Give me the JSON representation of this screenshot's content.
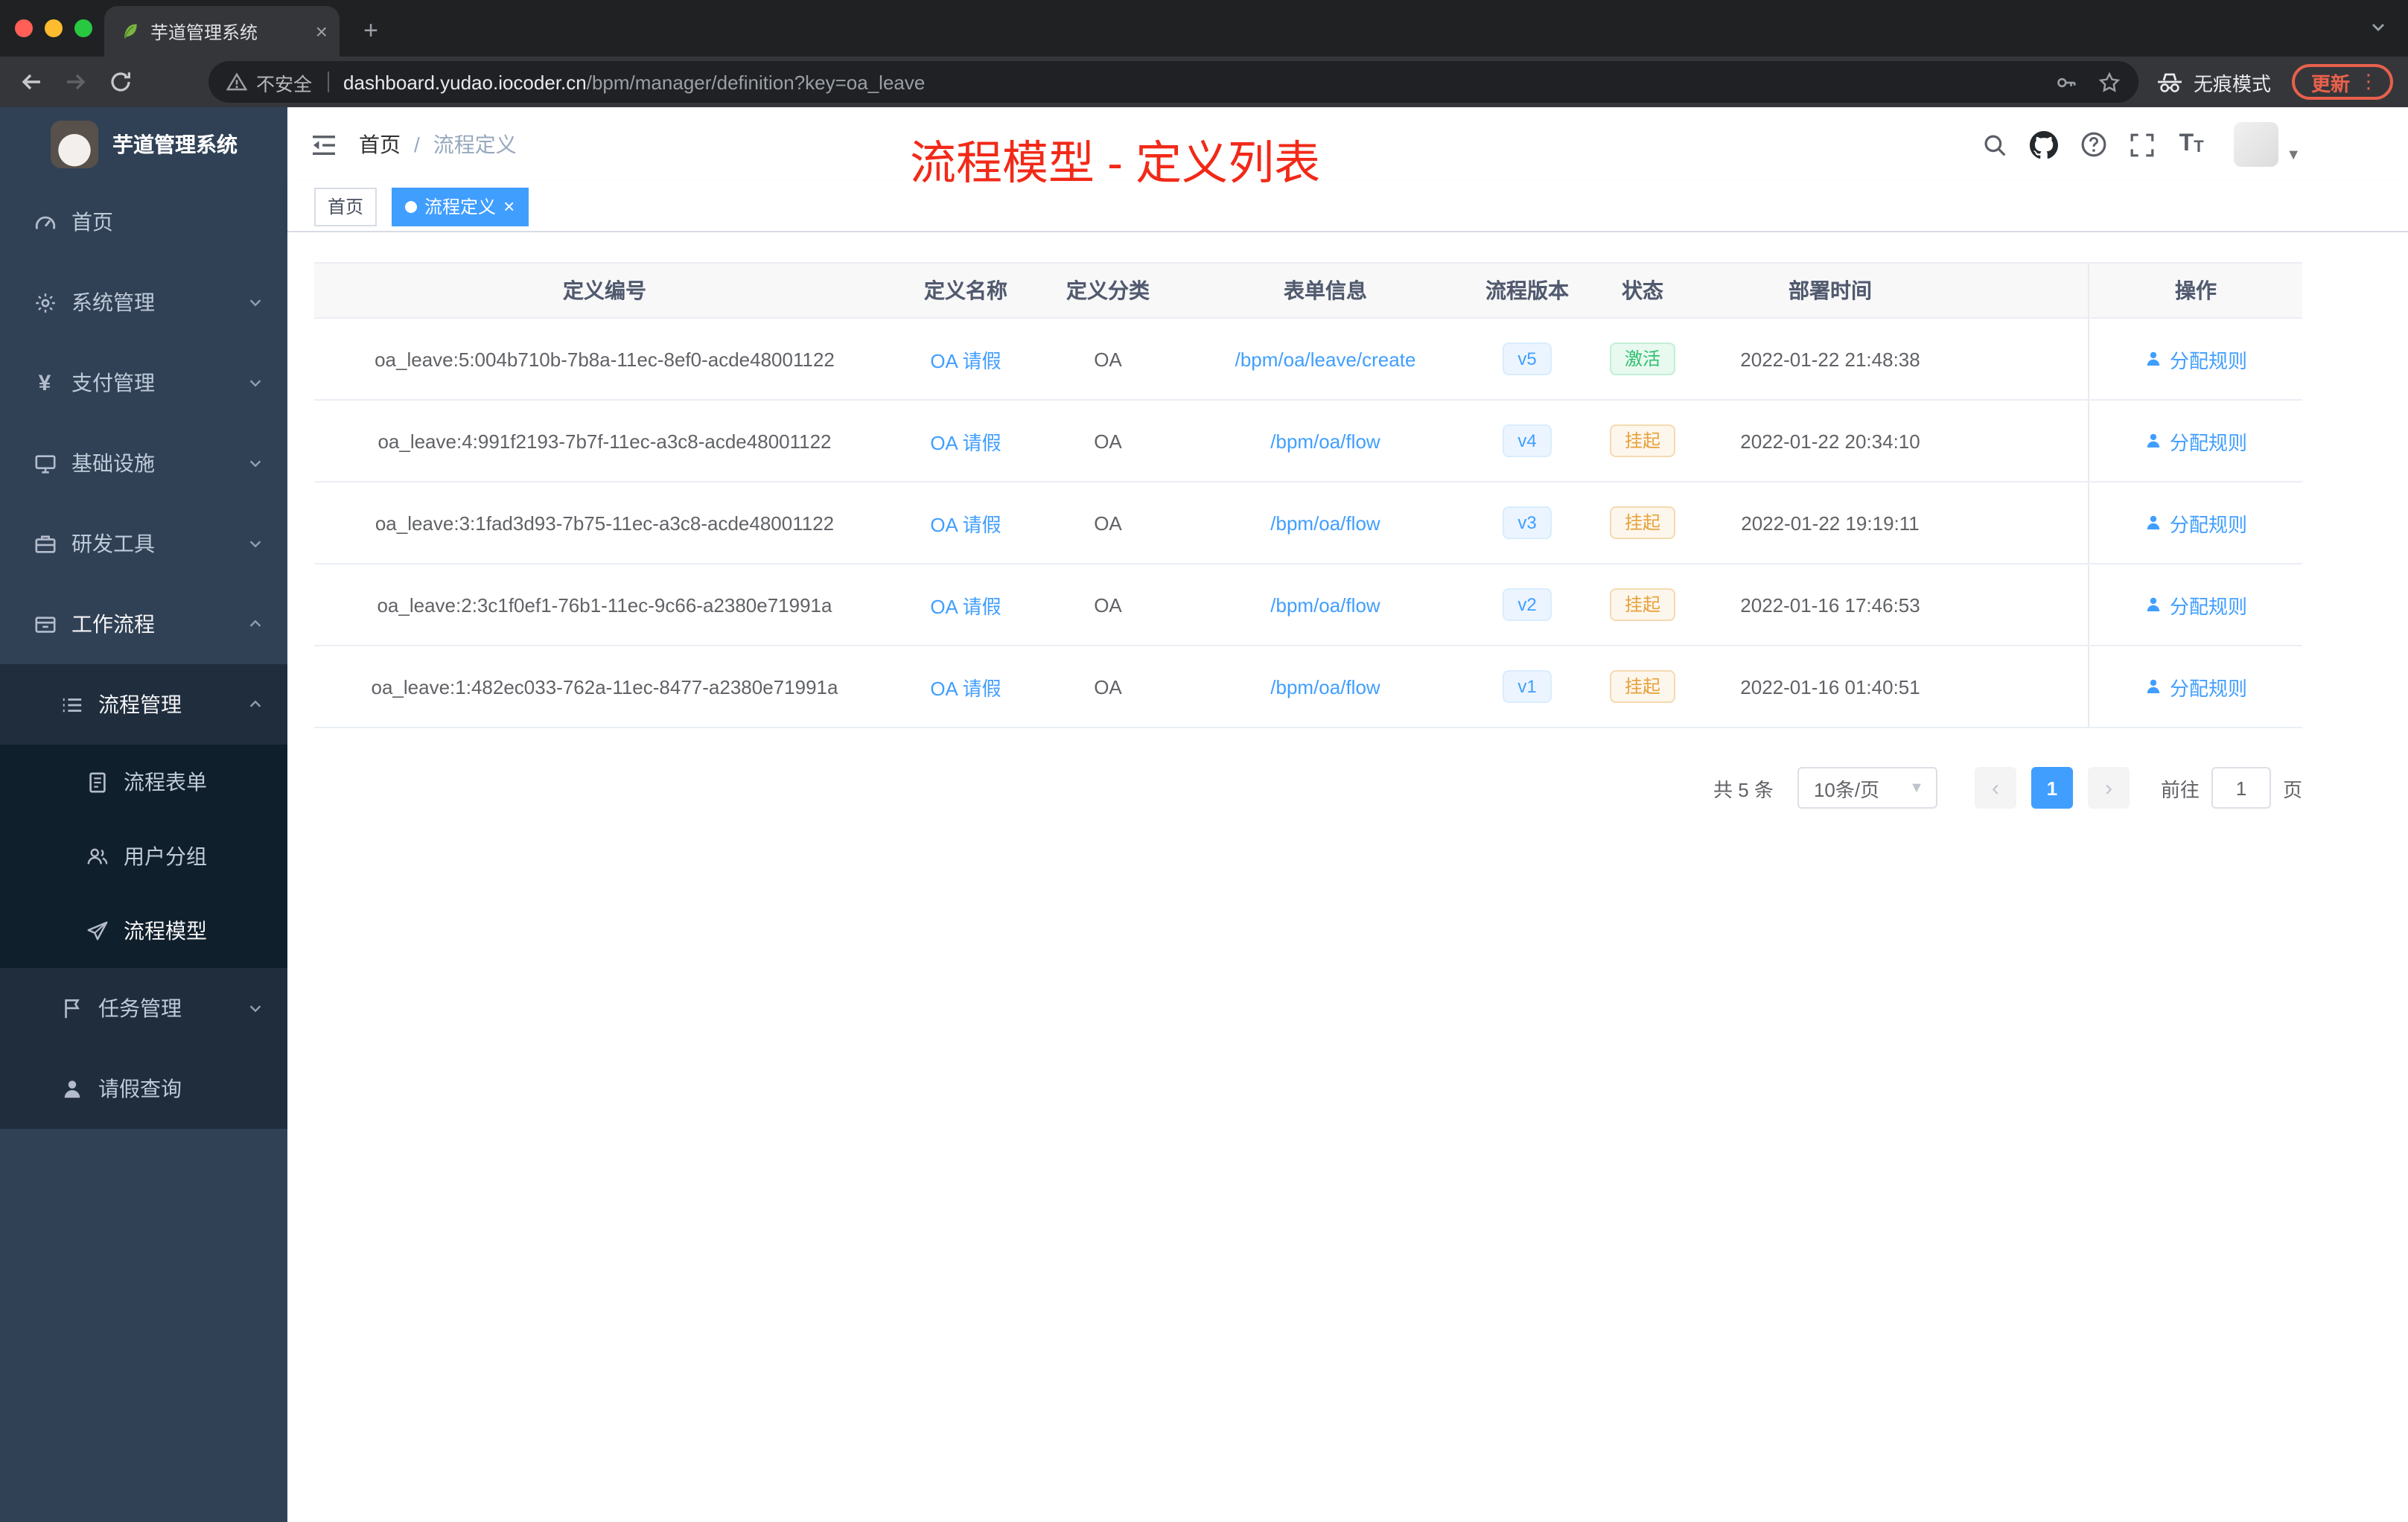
{
  "browser": {
    "tab_title": "芋道管理系统",
    "new_tab_label": "+",
    "close_label": "×",
    "security_label": "不安全",
    "url_domain": "dashboard.yudao.iocoder.cn",
    "url_path": "/bpm/manager/definition?key=oa_leave",
    "incognito_label": "无痕模式",
    "update_label": "更新",
    "menu_dots": "⋮"
  },
  "sidebar": {
    "logo_title": "芋道管理系统",
    "items": [
      {
        "label": "首页"
      },
      {
        "label": "系统管理"
      },
      {
        "label": "支付管理"
      },
      {
        "label": "基础设施"
      },
      {
        "label": "研发工具"
      },
      {
        "label": "工作流程"
      },
      {
        "label": "流程管理"
      },
      {
        "label": "流程表单"
      },
      {
        "label": "用户分组"
      },
      {
        "label": "流程模型"
      },
      {
        "label": "任务管理"
      },
      {
        "label": "请假查询"
      }
    ]
  },
  "navbar": {
    "breadcrumb_home": "首页",
    "breadcrumb_sep": "/",
    "breadcrumb_current": "流程定义",
    "annotation": "流程模型 - 定义列表"
  },
  "tags": {
    "home": "首页",
    "active": "流程定义",
    "close": "×"
  },
  "table": {
    "columns": [
      "定义编号",
      "定义名称",
      "定义分类",
      "表单信息",
      "流程版本",
      "状态",
      "部署时间",
      "操作"
    ],
    "rows": [
      {
        "id": "oa_leave:5:004b710b-7b8a-11ec-8ef0-acde48001122",
        "name": "OA 请假",
        "category": "OA",
        "form": "/bpm/oa/leave/create",
        "version": "v5",
        "status": "激活",
        "status_type": "success",
        "time": "2022-01-22 21:48:38",
        "action": "分配规则"
      },
      {
        "id": "oa_leave:4:991f2193-7b7f-11ec-a3c8-acde48001122",
        "name": "OA 请假",
        "category": "OA",
        "form": "/bpm/oa/flow",
        "version": "v4",
        "status": "挂起",
        "status_type": "warning",
        "time": "2022-01-22 20:34:10",
        "action": "分配规则"
      },
      {
        "id": "oa_leave:3:1fad3d93-7b75-11ec-a3c8-acde48001122",
        "name": "OA 请假",
        "category": "OA",
        "form": "/bpm/oa/flow",
        "version": "v3",
        "status": "挂起",
        "status_type": "warning",
        "time": "2022-01-22 19:19:11",
        "action": "分配规则"
      },
      {
        "id": "oa_leave:2:3c1f0ef1-76b1-11ec-9c66-a2380e71991a",
        "name": "OA 请假",
        "category": "OA",
        "form": "/bpm/oa/flow",
        "version": "v2",
        "status": "挂起",
        "status_type": "warning",
        "time": "2022-01-16 17:46:53",
        "action": "分配规则"
      },
      {
        "id": "oa_leave:1:482ec033-762a-11ec-8477-a2380e71991a",
        "name": "OA 请假",
        "category": "OA",
        "form": "/bpm/oa/flow",
        "version": "v1",
        "status": "挂起",
        "status_type": "warning",
        "time": "2022-01-16 01:40:51",
        "action": "分配规则"
      }
    ]
  },
  "pagination": {
    "total": "共 5 条",
    "page_size": "10条/页",
    "prev": "‹",
    "page": "1",
    "next": "›",
    "goto_label": "前往",
    "goto_value": "1",
    "page_unit": "页"
  },
  "colors": {
    "accent": "#409eff",
    "sidebar_bg": "#304156",
    "success": "#2fbf71",
    "warning": "#e6a23c",
    "annotation_red": "#f22918"
  }
}
